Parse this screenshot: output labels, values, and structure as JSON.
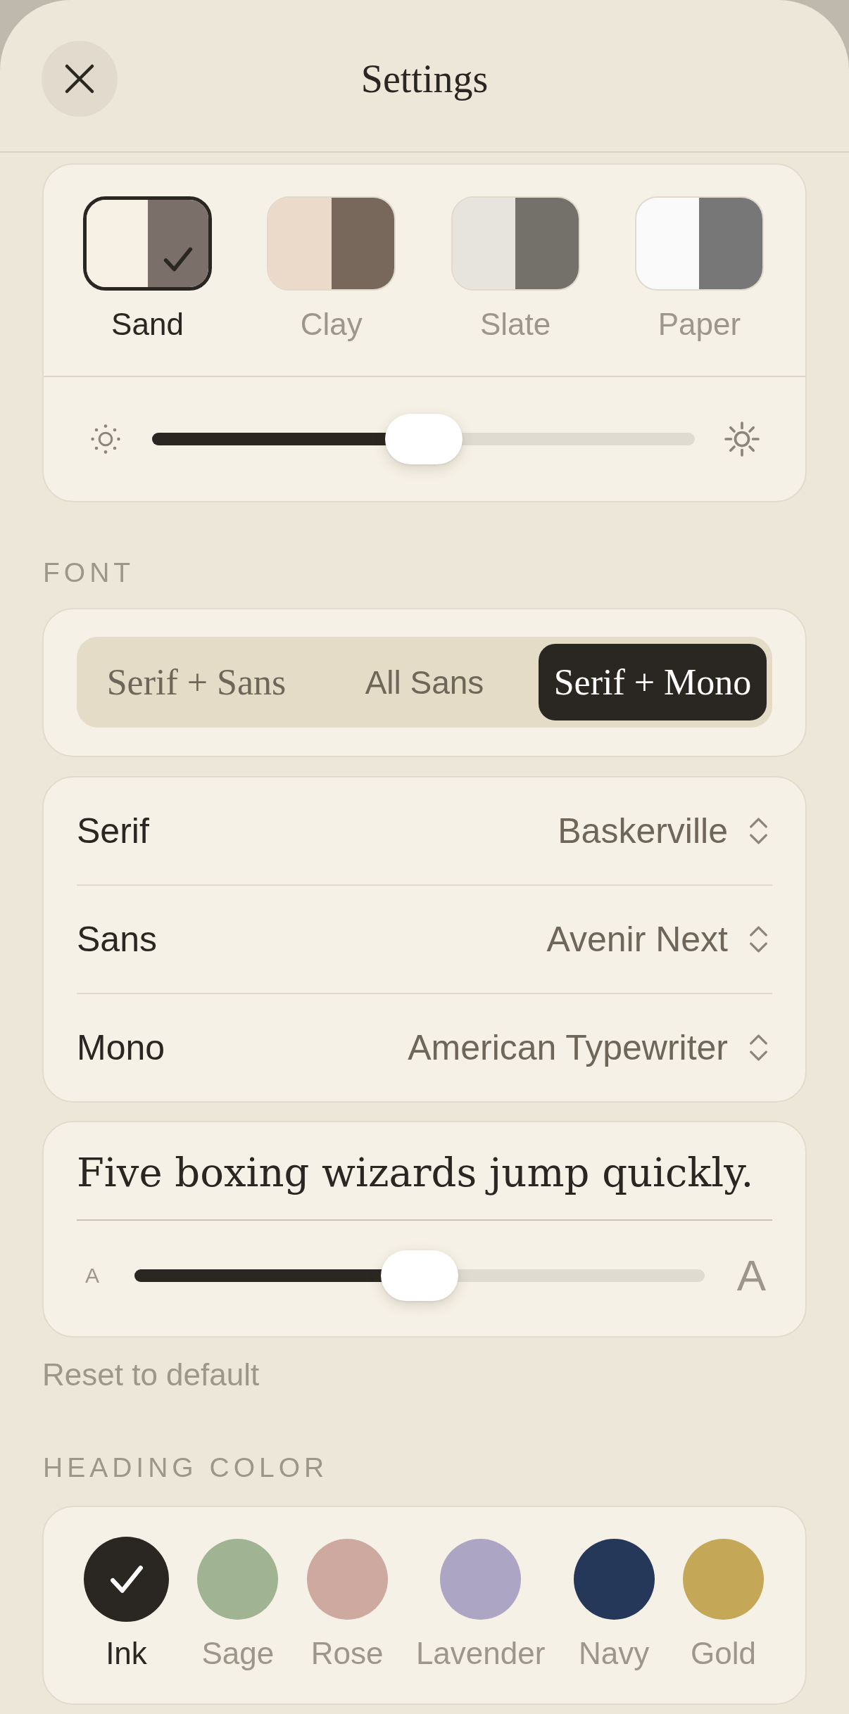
{
  "header": {
    "title": "Settings"
  },
  "themes": [
    {
      "label": "Sand",
      "selected": true,
      "halves": [
        {
          "color": "#f6f0e5"
        },
        {
          "color": "#7a7069"
        }
      ]
    },
    {
      "label": "Clay",
      "selected": false,
      "halves": [
        {
          "color": "#ebdac9"
        },
        {
          "color": "#77685b"
        }
      ]
    },
    {
      "label": "Slate",
      "selected": false,
      "halves": [
        {
          "color": "#e7e4de"
        },
        {
          "color": "#74716b"
        }
      ]
    },
    {
      "label": "Paper",
      "selected": false,
      "halves": [
        {
          "color": "#fafafa"
        },
        {
          "color": "#777777"
        }
      ]
    }
  ],
  "brightness": {
    "level": 0.5
  },
  "font_section": {
    "heading": "FONT",
    "presets": [
      {
        "label": "Serif + Sans",
        "kind": "serif",
        "selected": false
      },
      {
        "label": "All Sans",
        "kind": "sans",
        "selected": false
      },
      {
        "label": "Serif + Mono",
        "kind": "serif",
        "selected": true
      }
    ]
  },
  "font_rows": [
    {
      "label": "Serif",
      "value": "Baskerville"
    },
    {
      "label": "Sans",
      "value": "Avenir Next"
    },
    {
      "label": "Mono",
      "value": "American Typewriter"
    }
  ],
  "preview": {
    "text": "Five boxing wizards jump quickly.",
    "min_label": "A",
    "max_label": "A",
    "size": {
      "level": 0.5
    }
  },
  "reset_link": "Reset to default",
  "heading_color": {
    "heading": "HEADING COLOR",
    "swatches": [
      {
        "label": "Ink",
        "color": "#2a2722",
        "selected": true
      },
      {
        "label": "Sage",
        "color": "#a0b392",
        "selected": false
      },
      {
        "label": "Rose",
        "color": "#cda9a0",
        "selected": false
      },
      {
        "label": "Lavender",
        "color": "#ada5c4",
        "selected": false
      },
      {
        "label": "Navy",
        "color": "#25385a",
        "selected": false
      },
      {
        "label": "Gold",
        "color": "#c4a857",
        "selected": false
      }
    ]
  }
}
